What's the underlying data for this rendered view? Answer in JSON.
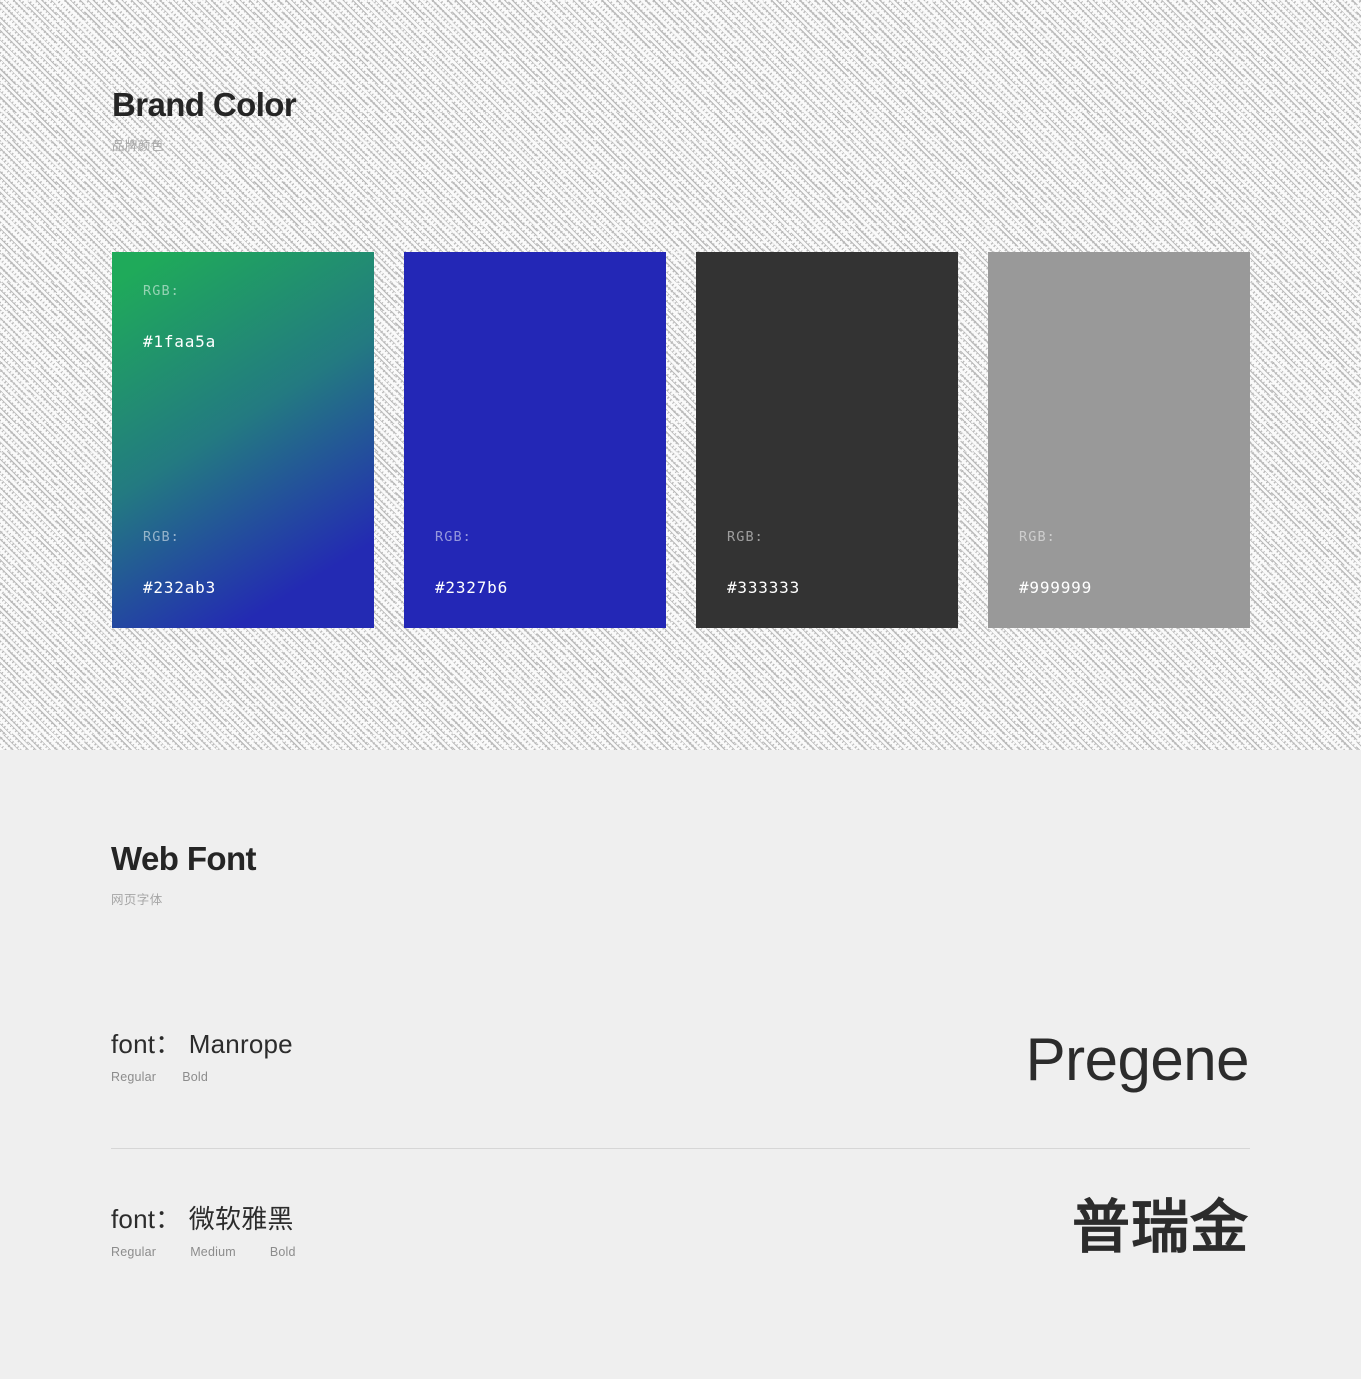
{
  "sections": {
    "brand_color": {
      "title": "Brand Color",
      "subtitle": "品牌颜色",
      "swatches": [
        {
          "name": "primary-gradient",
          "type": "gradient",
          "gradient_from": "#1faa5a",
          "gradient_to": "#232ab3",
          "entries": [
            {
              "label": "RGB:",
              "value": "#1faa5a"
            },
            {
              "label": "RGB:",
              "value": "#232ab3"
            }
          ]
        },
        {
          "name": "brand-blue",
          "type": "solid",
          "color": "#2327b6",
          "entries": [
            {
              "label": "RGB:",
              "value": "#2327b6"
            }
          ]
        },
        {
          "name": "neutral-dark",
          "type": "solid",
          "color": "#333333",
          "entries": [
            {
              "label": "RGB:",
              "value": "#333333"
            }
          ]
        },
        {
          "name": "neutral-gray",
          "type": "solid",
          "color": "#999999",
          "entries": [
            {
              "label": "RGB:",
              "value": "#999999"
            }
          ]
        }
      ]
    },
    "web_font": {
      "title": "Web Font",
      "subtitle": "网页字体",
      "rows": [
        {
          "name": "font：  Manrope",
          "weights": [
            "Regular",
            "Bold"
          ],
          "sample": "Pregene"
        },
        {
          "name": "font：  微软雅黑",
          "weights": [
            "Regular",
            "Medium",
            "Bold"
          ],
          "sample": "普瑞金"
        }
      ]
    }
  }
}
